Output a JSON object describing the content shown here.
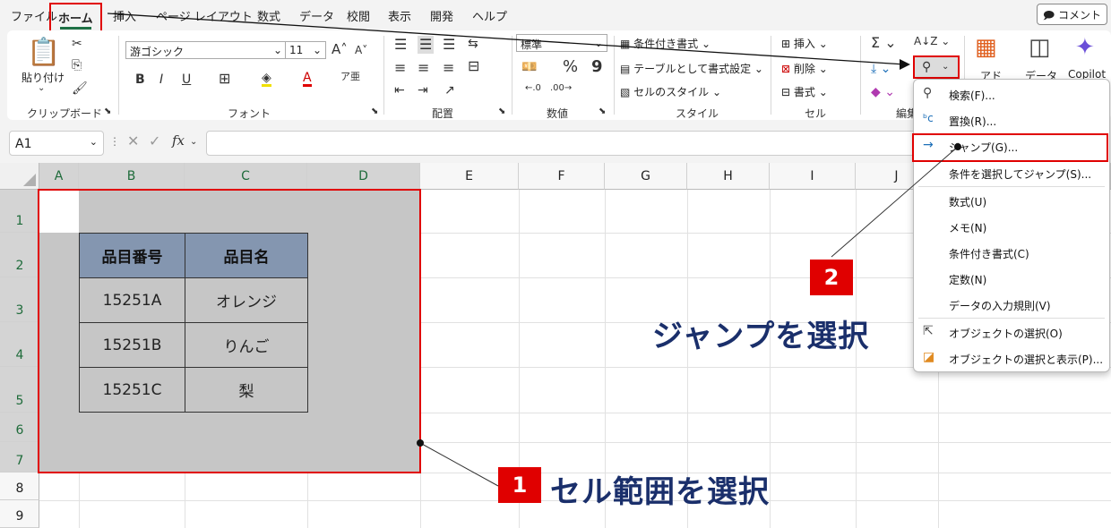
{
  "menu": {
    "tabs": [
      "ファイル",
      "ホーム",
      "挿入",
      "ページ レイアウト",
      "数式",
      "データ",
      "校閲",
      "表示",
      "開発",
      "ヘルプ"
    ],
    "comment": "コメント"
  },
  "ribbon": {
    "clipboard": {
      "paste": "貼り付け",
      "label": "クリップボード"
    },
    "font": {
      "name": "游ゴシック",
      "size": "11",
      "bold": "B",
      "italic": "I",
      "underline": "U",
      "label": "フォント"
    },
    "alignment": {
      "label": "配置"
    },
    "number": {
      "format": "標準",
      "percent": "%",
      "comma": "9",
      "label": "数値"
    },
    "styles": {
      "conditional": "条件付き書式",
      "table": "テーブルとして書式設定",
      "cell": "セルのスタイル",
      "label": "スタイル"
    },
    "cells": {
      "insert": "挿入",
      "delete": "削除",
      "format": "書式",
      "label": "セル"
    },
    "editing": {
      "label": "編集"
    },
    "addins": {
      "label": "アド"
    },
    "data": {
      "label": "データ"
    },
    "copilot": {
      "label": "Copilot"
    }
  },
  "formula_bar": {
    "namebox": "A1",
    "fx": "fx"
  },
  "columns": [
    "A",
    "B",
    "C",
    "D",
    "E",
    "F",
    "G",
    "H",
    "I",
    "J"
  ],
  "rows": [
    "1",
    "2",
    "3",
    "4",
    "5",
    "6",
    "7",
    "8",
    "9"
  ],
  "table": {
    "headers": [
      "品目番号",
      "品目名"
    ],
    "rows": [
      [
        "15251A",
        "オレンジ"
      ],
      [
        "15251B",
        "りんご"
      ],
      [
        "15251C",
        "梨"
      ]
    ]
  },
  "find_menu": {
    "items": [
      "検索(F)...",
      "置換(R)...",
      "ジャンプ(G)...",
      "条件を選択してジャンプ(S)...",
      "数式(U)",
      "メモ(N)",
      "条件付き書式(C)",
      "定数(N)",
      "データの入力規則(V)",
      "オブジェクトの選択(O)",
      "オブジェクトの選択と表示(P)..."
    ]
  },
  "annotations": {
    "step1_num": "1",
    "step1_text": "セル範囲を選択",
    "step2_num": "2",
    "step2_text": "ジャンプを選択"
  },
  "colors": {
    "highlight": "#e00000",
    "callout": "#1a2f6b",
    "table_header": "#8496b0",
    "selection": "#c6c6c6"
  }
}
